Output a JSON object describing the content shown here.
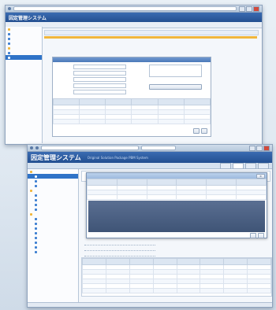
{
  "win1": {
    "address": "",
    "app_title": "因定管理システム",
    "menu": [
      "",
      "",
      "",
      "",
      ""
    ],
    "sidebar": [
      "",
      "",
      "",
      "",
      "",
      "",
      "",
      ""
    ],
    "form_title": "",
    "form_labels": [
      "",
      "",
      "",
      "",
      "",
      ""
    ],
    "buttons": [
      "",
      "",
      ""
    ],
    "table_headers": [
      "",
      "",
      "",
      "",
      "",
      "",
      ""
    ],
    "rows": 4
  },
  "win2": {
    "address": "",
    "search_placeholder": "",
    "app_title": "因定管理システム",
    "subtitle": "Original Solution Package PBM System",
    "tabs": [
      "",
      "",
      "",
      ""
    ],
    "sidebar": [
      {
        "label": "",
        "color": "#f0b63c",
        "selected": false
      },
      {
        "label": "",
        "color": "#3d7fd1",
        "selected": true
      },
      {
        "label": "",
        "color": "#3d7fd1",
        "selected": false
      },
      {
        "label": "",
        "color": "#3d7fd1",
        "selected": false
      },
      {
        "label": "",
        "color": "#f0b63c",
        "selected": false
      },
      {
        "label": "",
        "color": "#3d7fd1",
        "selected": false
      },
      {
        "label": "",
        "color": "#3d7fd1",
        "selected": false
      },
      {
        "label": "",
        "color": "#3d7fd1",
        "selected": false
      },
      {
        "label": "",
        "color": "#3d7fd1",
        "selected": false
      },
      {
        "label": "",
        "color": "#f0b63c",
        "selected": false
      },
      {
        "label": "",
        "color": "#3d7fd1",
        "selected": false
      },
      {
        "label": "",
        "color": "#3d7fd1",
        "selected": false
      },
      {
        "label": "",
        "color": "#3d7fd1",
        "selected": false
      },
      {
        "label": "",
        "color": "#3d7fd1",
        "selected": false
      },
      {
        "label": "",
        "color": "#3d7fd1",
        "selected": false
      },
      {
        "label": "",
        "color": "#3d7fd1",
        "selected": false
      },
      {
        "label": "",
        "color": "#3d7fd1",
        "selected": false
      },
      {
        "label": "",
        "color": "#3d7fd1",
        "selected": false
      }
    ],
    "dialog_headers": [
      "",
      "",
      "",
      "",
      "",
      "",
      ""
    ],
    "dialog_rows": 4,
    "grid_headers": [
      "",
      "",
      "",
      "",
      "",
      "",
      "",
      ""
    ],
    "grid_rows": 6,
    "status": ""
  },
  "colors": {
    "header": "#2a5aa0",
    "selected": "#2f73c8",
    "accent": "#f0b63c"
  }
}
